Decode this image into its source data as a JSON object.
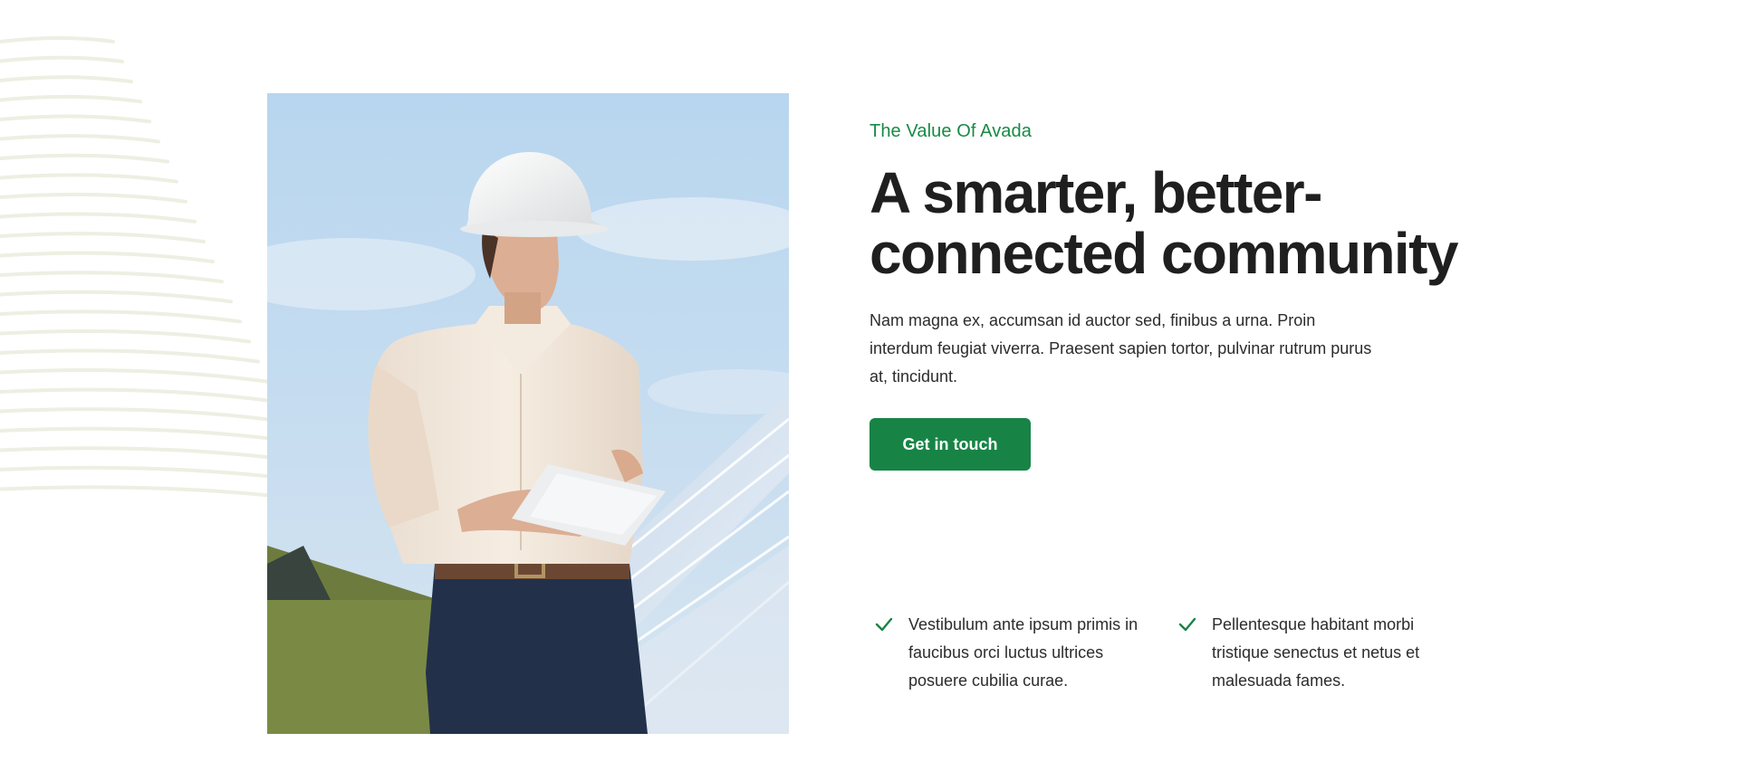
{
  "section": {
    "eyebrow": "The Value Of Avada",
    "headline_line1": "A smarter, better-",
    "headline_line2": "connected community",
    "body": "Nam magna ex, accumsan id auctor sed, finibus a urna. Proin interdum feugiat viverra. Praesent sapien tortor, pulvinar rutrum purus at, tincidunt.",
    "cta_label": "Get in touch"
  },
  "features": [
    {
      "icon": "check-icon",
      "text": "Vestibulum ante ipsum primis in faucibus orci luctus ultrices posuere cubilia curae."
    },
    {
      "icon": "check-icon",
      "text": "Pellentesque habitant morbi tristique senectus et netus et malesuada fames."
    }
  ],
  "photo": {
    "subject": "engineer-with-hard-hat-and-tablet-by-solar-panels"
  },
  "colors": {
    "accent": "#178446",
    "eyebrow": "#178a46",
    "heading": "#1f1f1f",
    "body": "#2c2c2c",
    "decor_lines": "#eeeee2"
  }
}
